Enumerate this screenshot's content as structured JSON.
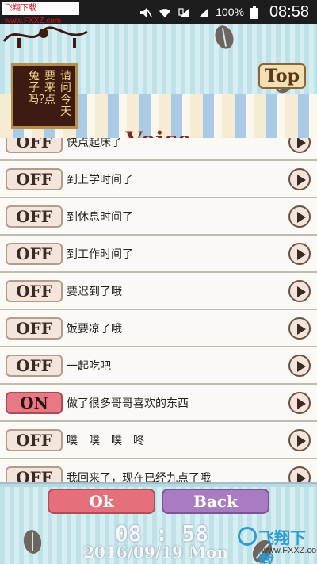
{
  "status_bar": {
    "watermark": "飞翔下载 www.FXXZ.com",
    "battery": "100%",
    "time": "08:58"
  },
  "header": {
    "sign_columns": [
      "请问今天",
      "要来点",
      "兔子吗？"
    ],
    "top_label": "Top",
    "title": "Voice"
  },
  "voice_list": [
    {
      "state": "OFF",
      "label": "快点起床了"
    },
    {
      "state": "OFF",
      "label": "到上学时间了"
    },
    {
      "state": "OFF",
      "label": "到休息时间了"
    },
    {
      "state": "OFF",
      "label": "到工作时间了"
    },
    {
      "state": "OFF",
      "label": "要迟到了哦"
    },
    {
      "state": "OFF",
      "label": "饭要凉了哦"
    },
    {
      "state": "OFF",
      "label": "一起吃吧"
    },
    {
      "state": "ON",
      "label": "做了很多哥哥喜欢的东西"
    },
    {
      "state": "OFF",
      "label": "噗　噗　噗　咚"
    },
    {
      "state": "OFF",
      "label": "我回来了，现在已经九点了哦"
    }
  ],
  "footer": {
    "ok_label": "Ok",
    "back_label": "Back",
    "time": "08 : 58",
    "date": "2016/09/19  Mon",
    "watermark_big": "飞翔下载",
    "watermark_small": "www.FXXZ.com"
  },
  "colors": {
    "on": "#e87883",
    "off": "#f3e4dc",
    "ok": "#e56f7b",
    "back": "#a97cc2"
  }
}
